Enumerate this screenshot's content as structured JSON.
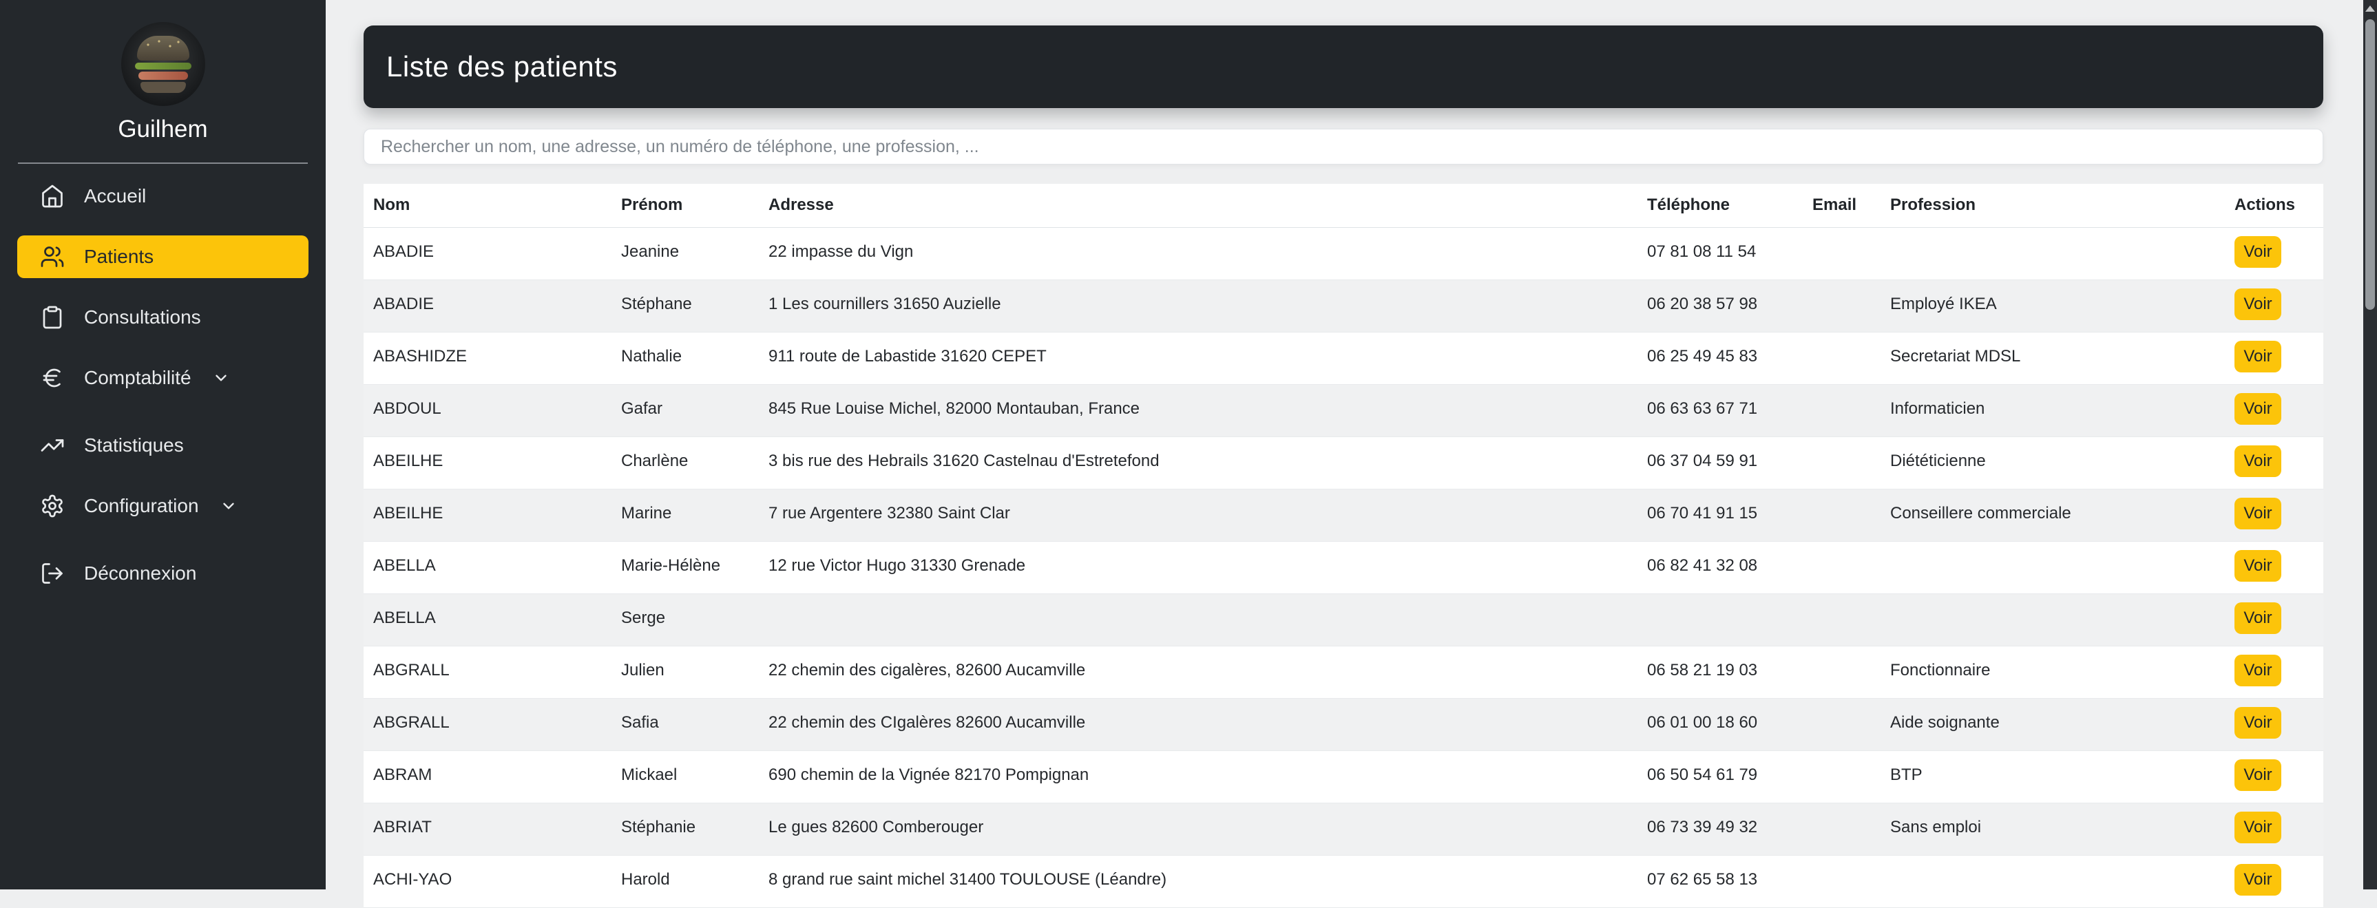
{
  "sidebar": {
    "user_name": "Guilhem",
    "items": [
      {
        "label": "Accueil",
        "icon": "home",
        "active": false,
        "chevron": false,
        "spacer": false
      },
      {
        "label": "Patients",
        "icon": "users",
        "active": true,
        "chevron": false,
        "spacer": false
      },
      {
        "label": "Consultations",
        "icon": "clipboard",
        "active": false,
        "chevron": false,
        "spacer": false
      },
      {
        "label": "Comptabilité",
        "icon": "euro",
        "active": false,
        "chevron": true,
        "spacer": false
      },
      {
        "label": "Statistiques",
        "icon": "trending-up",
        "active": false,
        "chevron": false,
        "spacer": true
      },
      {
        "label": "Configuration",
        "icon": "gear",
        "active": false,
        "chevron": true,
        "spacer": false
      },
      {
        "label": "Déconnexion",
        "icon": "logout",
        "active": false,
        "chevron": false,
        "spacer": true
      }
    ]
  },
  "header": {
    "title": "Liste des patients"
  },
  "search": {
    "placeholder": "Rechercher un nom, une adresse, un numéro de téléphone, une profession, ..."
  },
  "table": {
    "columns": [
      "Nom",
      "Prénom",
      "Adresse",
      "Téléphone",
      "Email",
      "Profession",
      "Actions"
    ],
    "action_label": "Voir",
    "rows": [
      {
        "nom": "ABADIE",
        "prenom": "Jeanine",
        "adresse": "22 impasse du Vign",
        "telephone": "07 81 08 11 54",
        "email": "",
        "profession": ""
      },
      {
        "nom": "ABADIE",
        "prenom": "Stéphane",
        "adresse": "1 Les cournillers 31650 Auzielle",
        "telephone": "06 20 38 57 98",
        "email": "",
        "profession": "Employé IKEA"
      },
      {
        "nom": "ABASHIDZE",
        "prenom": "Nathalie",
        "adresse": "911 route de Labastide 31620 CEPET",
        "telephone": "06 25 49 45 83",
        "email": "",
        "profession": "Secretariat MDSL"
      },
      {
        "nom": "ABDOUL",
        "prenom": "Gafar",
        "adresse": "845 Rue Louise Michel, 82000 Montauban, France",
        "telephone": "06 63 63 67 71",
        "email": "",
        "profession": "Informaticien"
      },
      {
        "nom": "ABEILHE",
        "prenom": "Charlène",
        "adresse": "3 bis rue des Hebrails 31620 Castelnau d'Estretefond",
        "telephone": "06 37 04 59 91",
        "email": "",
        "profession": "Diététicienne"
      },
      {
        "nom": "ABEILHE",
        "prenom": "Marine",
        "adresse": "7 rue Argentere 32380 Saint Clar",
        "telephone": "06 70 41 91 15",
        "email": "",
        "profession": "Conseillere commerciale"
      },
      {
        "nom": "ABELLA",
        "prenom": "Marie-Hélène",
        "adresse": "12 rue Victor Hugo 31330 Grenade",
        "telephone": "06 82 41 32 08",
        "email": "",
        "profession": ""
      },
      {
        "nom": "ABELLA",
        "prenom": "Serge",
        "adresse": "",
        "telephone": "",
        "email": "",
        "profession": ""
      },
      {
        "nom": "ABGRALL",
        "prenom": "Julien",
        "adresse": "22 chemin des cigalères, 82600 Aucamville",
        "telephone": "06 58 21 19 03",
        "email": "",
        "profession": "Fonctionnaire"
      },
      {
        "nom": "ABGRALL",
        "prenom": "Safia",
        "adresse": "22 chemin des CIgalères 82600 Aucamville",
        "telephone": "06 01 00 18 60",
        "email": "",
        "profession": "Aide soignante"
      },
      {
        "nom": "ABRAM",
        "prenom": "Mickael",
        "adresse": "690 chemin de la Vignée 82170 Pompignan",
        "telephone": "06 50 54 61 79",
        "email": "",
        "profession": "BTP"
      },
      {
        "nom": "ABRIAT",
        "prenom": "Stéphanie",
        "adresse": "Le gues 82600 Comberouger",
        "telephone": "06 73 39 49 32",
        "email": "",
        "profession": "Sans emploi"
      },
      {
        "nom": "ACHI-YAO",
        "prenom": "Harold",
        "adresse": "8 grand rue saint michel 31400 TOULOUSE (Léandre)",
        "telephone": "07 62 65 58 13",
        "email": "",
        "profession": ""
      }
    ]
  },
  "colors": {
    "accent": "#fcc40a",
    "sidebar_bg": "#24282c",
    "header_bg": "#212529",
    "page_bg": "#eeeff0",
    "row_alt": "#f0f1f2",
    "scroll_track": "#2b2e32",
    "scroll_thumb": "#95999d"
  }
}
